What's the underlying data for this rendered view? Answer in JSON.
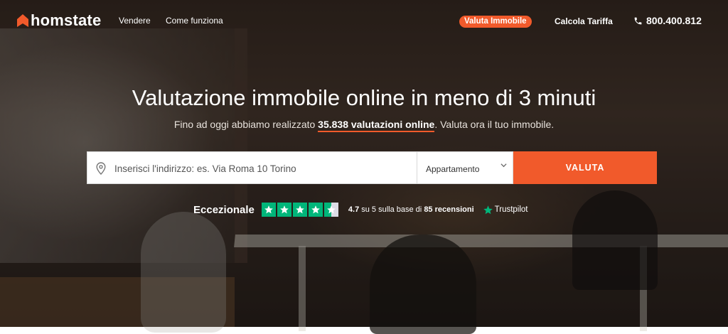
{
  "nav": {
    "logo_text": "homstate",
    "links": [
      "Vendere",
      "Come funziona"
    ],
    "badge": "Valuta Immobile",
    "calc": "Calcola Tariffa",
    "phone": "800.400.812"
  },
  "hero": {
    "title": "Valutazione immobile online in meno di 3 minuti",
    "sub_before": "Fino ad oggi abbiamo realizzato ",
    "sub_count": "35.838 valutazioni online",
    "sub_after": ". Valuta ora il tuo immobile."
  },
  "search": {
    "address_placeholder": "Inserisci l'indirizzo: es. Via Roma 10 Torino",
    "property_type": "Appartamento",
    "button": "VALUTA"
  },
  "trust": {
    "label": "Eccezionale",
    "rating_stars": 4.5,
    "text_pre": "4.7",
    "text_mid": " su 5 sulla base di ",
    "text_count": "85 recensioni",
    "brand": "Trustpilot"
  },
  "colors": {
    "accent": "#f15a2b",
    "trustpilot_green": "#00b67a"
  },
  "icons": {
    "logo": "house-roof-icon",
    "phone": "phone-icon",
    "address": "map-pin-icon",
    "select": "chevron-down-icon",
    "star": "star-icon"
  }
}
